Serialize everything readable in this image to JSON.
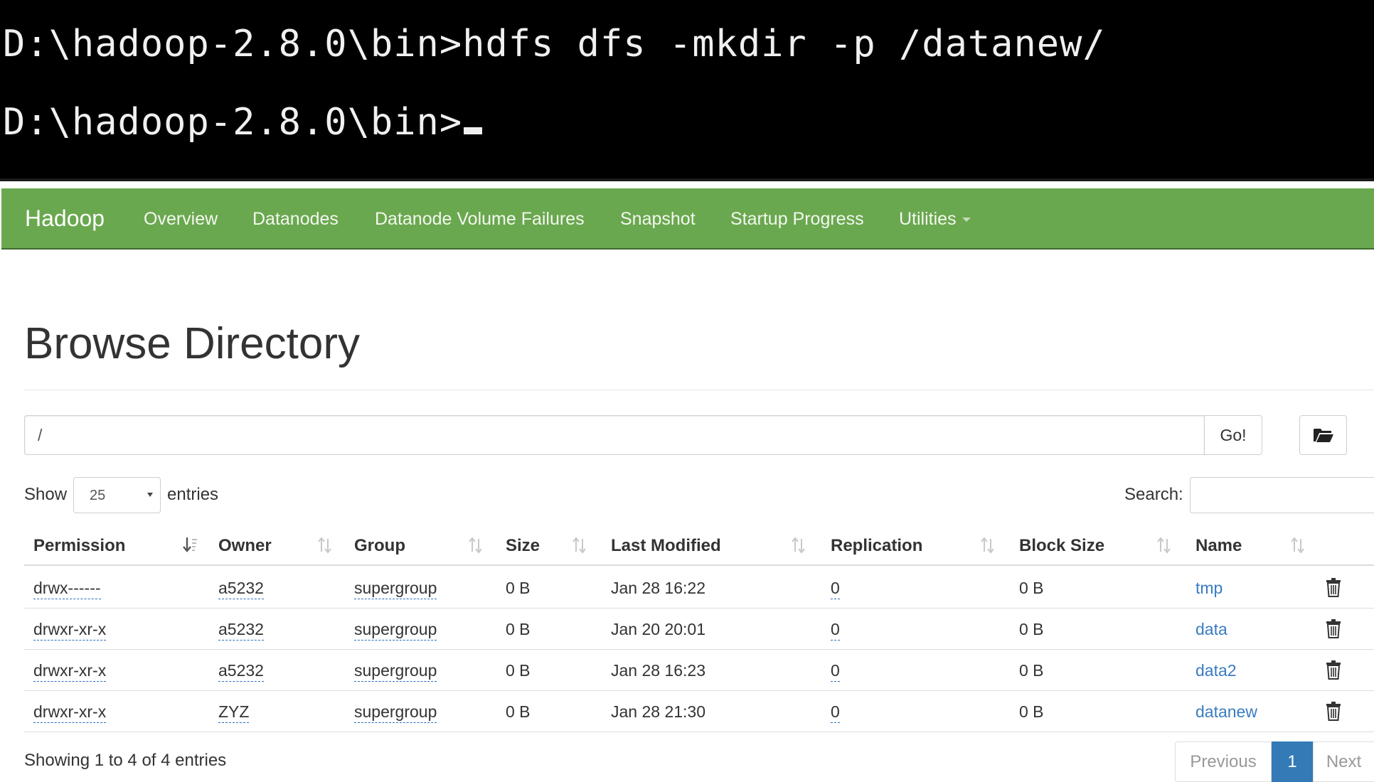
{
  "terminal": {
    "line1": "D:\\hadoop-2.8.0\\bin>hdfs dfs -mkdir -p /datanew/",
    "line2": "D:\\hadoop-2.8.0\\bin>"
  },
  "navbar": {
    "brand": "Hadoop",
    "items": [
      "Overview",
      "Datanodes",
      "Datanode Volume Failures",
      "Snapshot",
      "Startup Progress",
      "Utilities"
    ],
    "bg_color": "#6aa84f"
  },
  "page": {
    "title": "Browse Directory"
  },
  "path_bar": {
    "value": "/",
    "go_label": "Go!",
    "folder_icon": "folder-open-icon"
  },
  "table_controls": {
    "show_label": "Show",
    "entries_value": "25",
    "entries_label": "entries",
    "search_label": "Search:"
  },
  "table": {
    "headers": [
      "Permission",
      "Owner",
      "Group",
      "Size",
      "Last Modified",
      "Replication",
      "Block Size",
      "Name"
    ],
    "rows": [
      {
        "permission": "drwx------",
        "owner": "a5232",
        "group": "supergroup",
        "size": "0 B",
        "modified": "Jan 28 16:22",
        "replication": "0",
        "block_size": "0 B",
        "name": "tmp"
      },
      {
        "permission": "drwxr-xr-x",
        "owner": "a5232",
        "group": "supergroup",
        "size": "0 B",
        "modified": "Jan 20 20:01",
        "replication": "0",
        "block_size": "0 B",
        "name": "data"
      },
      {
        "permission": "drwxr-xr-x",
        "owner": "a5232",
        "group": "supergroup",
        "size": "0 B",
        "modified": "Jan 28 16:23",
        "replication": "0",
        "block_size": "0 B",
        "name": "data2"
      },
      {
        "permission": "drwxr-xr-x",
        "owner": "ZYZ",
        "group": "supergroup",
        "size": "0 B",
        "modified": "Jan 28 21:30",
        "replication": "0",
        "block_size": "0 B",
        "name": "datanew"
      }
    ]
  },
  "footer": {
    "showing": "Showing 1 to 4 of 4 entries",
    "previous": "Previous",
    "current_page": "1",
    "next": "Next"
  }
}
